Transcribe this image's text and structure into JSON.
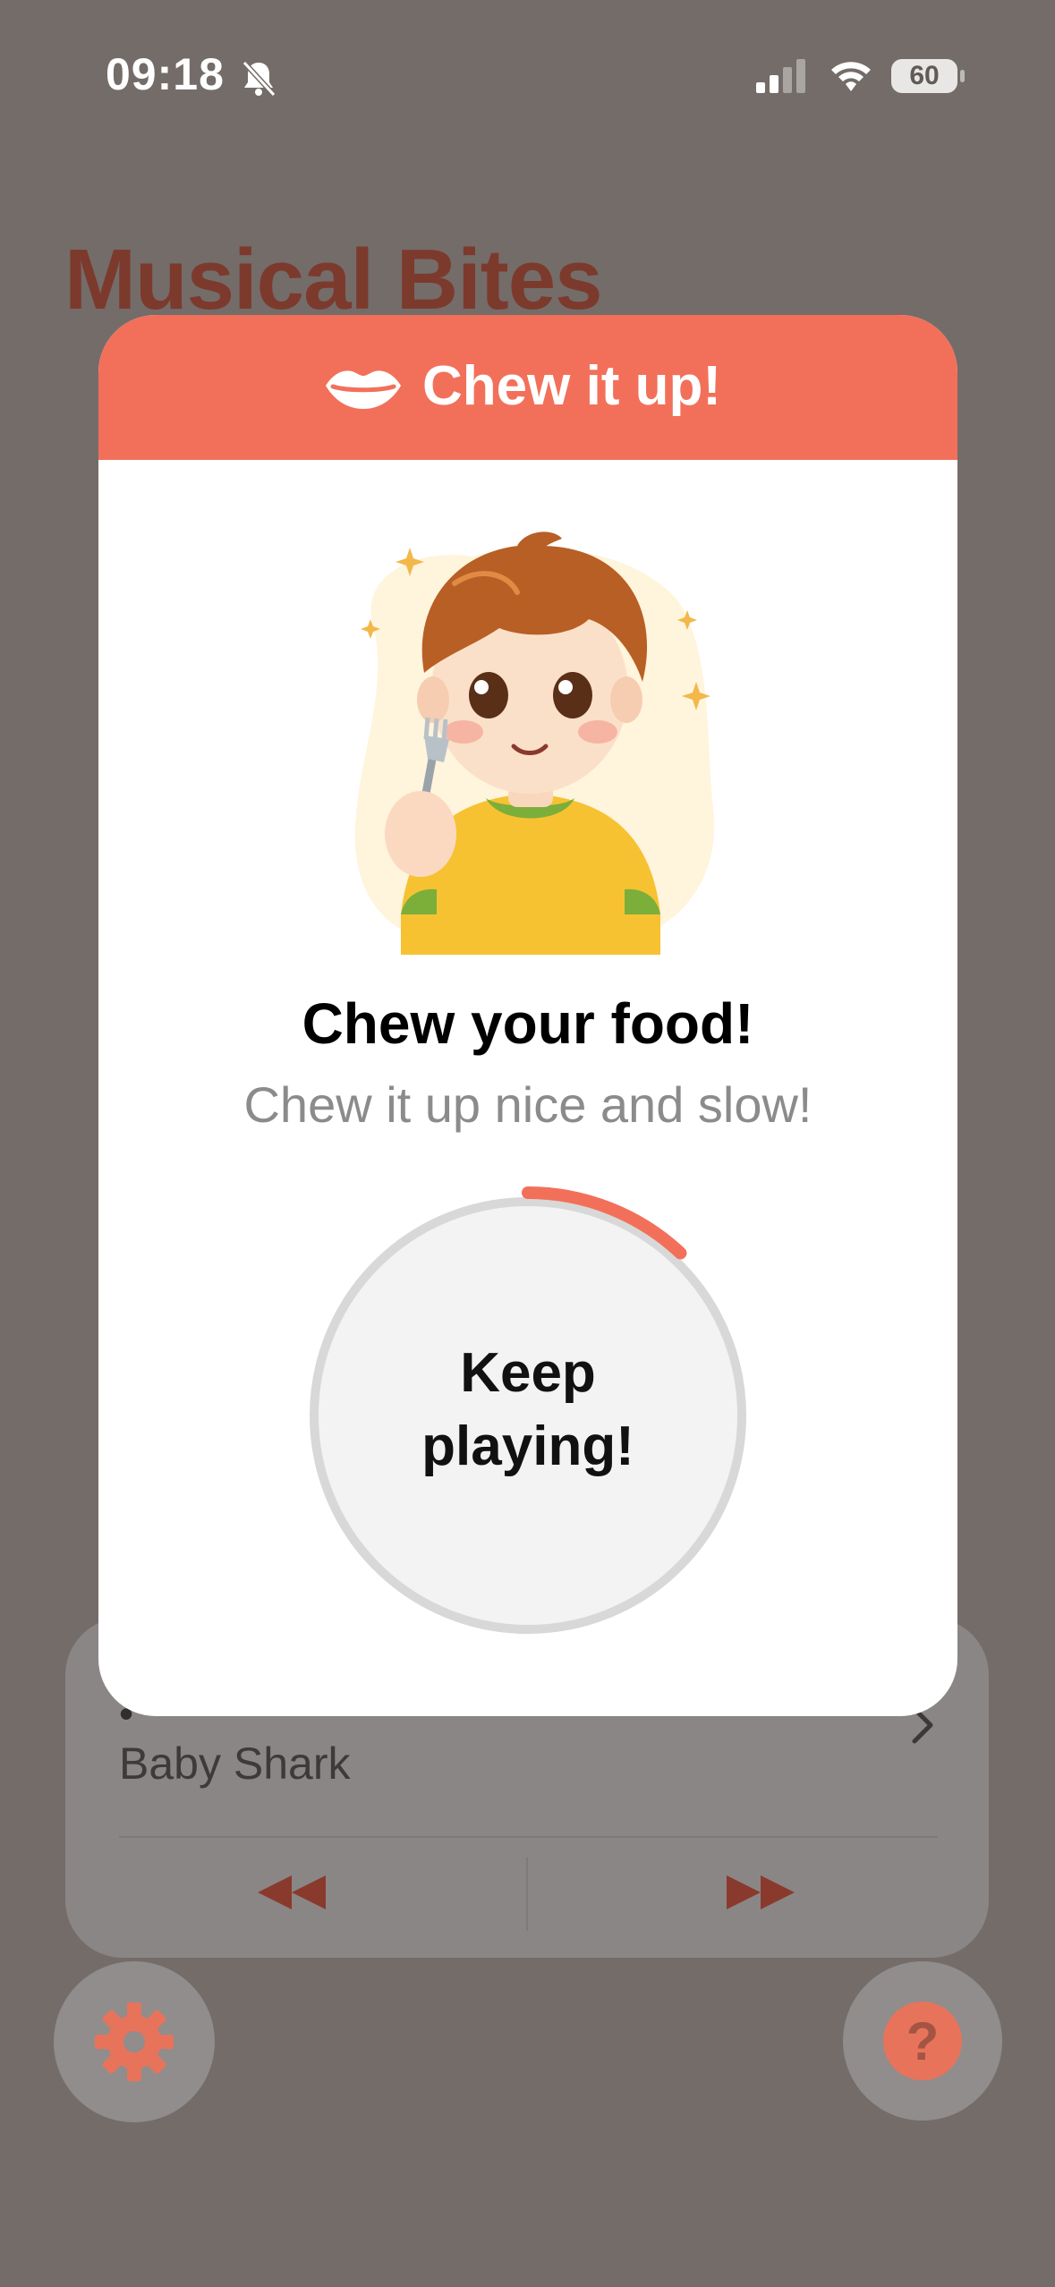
{
  "status_bar": {
    "time": "09:18",
    "battery": "60"
  },
  "app": {
    "title": "Musical Bites"
  },
  "now_playing": {
    "title": "•",
    "song": "Baby Shark"
  },
  "modal": {
    "header_title": "Chew it up!",
    "title": "Chew your food!",
    "subtitle": "Chew it up nice and slow!",
    "timer_label_line1": "Keep",
    "timer_label_line2": "playing!",
    "timer_progress": 0.12
  },
  "colors": {
    "accent": "#f2705a",
    "overlay": "#746c69",
    "title_dimmed": "#7c3a2d"
  },
  "icons": [
    "bell-slash-icon",
    "signal-icon",
    "wifi-icon",
    "battery-icon",
    "lips-icon",
    "chevron-right-icon",
    "rewind-icon",
    "fast-forward-icon",
    "gear-icon",
    "question-icon"
  ]
}
